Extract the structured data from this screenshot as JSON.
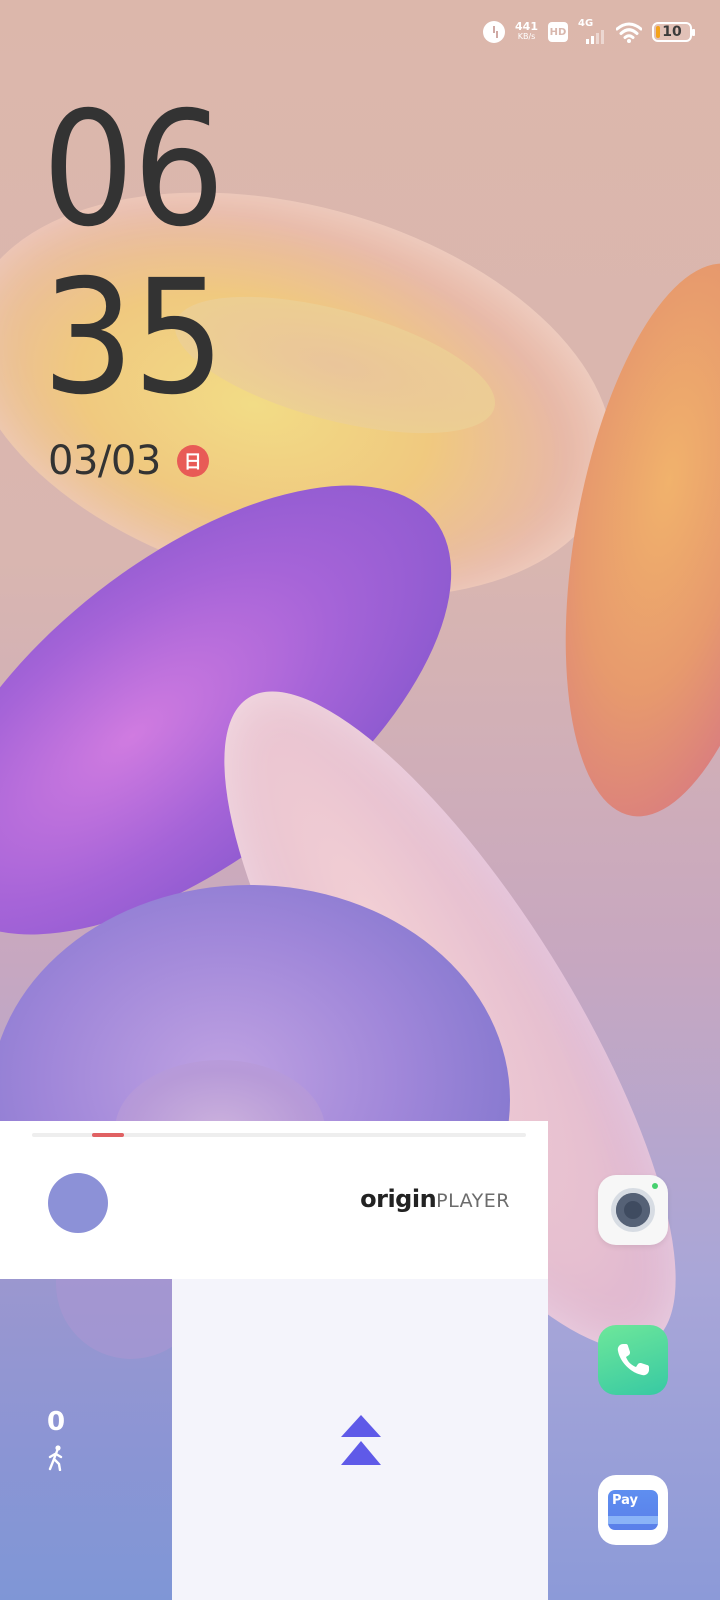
{
  "status_bar": {
    "net_speed": "441",
    "net_speed_unit": "KB/s",
    "hd_label": "HD",
    "network_type": "4G",
    "battery_level": "10",
    "icons": [
      "alarm-icon",
      "hd-icon",
      "signal-icon",
      "wifi-icon",
      "battery-icon"
    ]
  },
  "lockscreen": {
    "hour": "06",
    "minute": "35",
    "date": "03/03",
    "weekday_badge": "日"
  },
  "player": {
    "brand_left": "origin",
    "brand_right": "PLAYER",
    "progress_fraction": 0.065
  },
  "steps_widget": {
    "count": "0",
    "icon": "walking-person-icon"
  },
  "swipe_area": {
    "icon": "double-chevron-up-icon"
  },
  "shortcuts": [
    {
      "name": "camera",
      "icon": "camera-icon"
    },
    {
      "name": "phone",
      "icon": "phone-icon"
    },
    {
      "name": "pay",
      "label": "Pay",
      "icon": "wallet-card-icon"
    }
  ],
  "colors": {
    "accent_red": "#e06163",
    "badge_red": "#e85b56",
    "swipe_arrow": "#5f5ae8",
    "album_purple": "#8c91d7",
    "phone_green": "#4fd89f"
  }
}
